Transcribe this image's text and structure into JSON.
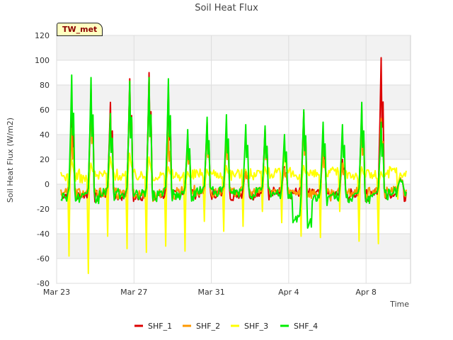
{
  "chart_data": {
    "type": "line",
    "title": "Soil Heat Flux",
    "xlabel": "Time",
    "ylabel": "Soil Heat Flux (W/m2)",
    "tag": "TW_met",
    "ylim": [
      -80,
      120
    ],
    "yticks": [
      -80,
      -60,
      -40,
      -20,
      0,
      20,
      40,
      60,
      80,
      100,
      120
    ],
    "xlim": [
      0,
      18.3
    ],
    "xticks": [
      {
        "t": 0,
        "label": "Mar 23"
      },
      {
        "t": 4,
        "label": "Mar 27"
      },
      {
        "t": 8,
        "label": "Mar 31"
      },
      {
        "t": 12,
        "label": "Apr 4"
      },
      {
        "t": 16,
        "label": "Apr 8"
      }
    ],
    "grid": true,
    "legend_position": "bottom",
    "day_offsets": [
      0.22,
      1.22,
      2.22,
      3.22,
      4.22,
      5.22,
      6.22,
      7.22,
      8.22,
      9.22,
      10.22,
      11.22,
      12.22,
      13.22,
      14.22,
      15.22,
      16.22,
      17.22
    ],
    "series": [
      {
        "name": "SHF_1",
        "color": "#dd0000",
        "peaks": [
          64,
          77,
          66,
          85,
          90,
          79,
          38,
          50,
          45,
          10,
          45,
          14,
          58,
          35,
          20,
          60,
          102,
          5
        ],
        "troughs": [
          -14,
          -14,
          -13,
          -16,
          -16,
          -14,
          -10,
          -12,
          -12,
          -13,
          -11,
          -10,
          -11,
          -13,
          -14,
          -13,
          -12,
          -13
        ]
      },
      {
        "name": "SHF_2",
        "color": "#ff9900",
        "peaks": [
          45,
          73,
          57,
          83,
          85,
          41,
          36,
          48,
          44,
          10,
          44,
          13,
          52,
          30,
          17,
          52,
          53,
          5
        ],
        "troughs": [
          -10,
          -12,
          -11,
          -13,
          -13,
          -12,
          -8,
          -10,
          -11,
          -10,
          -10,
          -9,
          -10,
          -12,
          -12,
          -11,
          -10,
          -9
        ]
      },
      {
        "name": "SHF_3",
        "color": "#ffff00",
        "peaks": [
          20,
          17,
          22,
          25,
          22,
          14,
          10,
          12,
          15,
          12,
          14,
          24,
          15,
          22,
          20,
          14,
          10,
          9
        ],
        "troughs": [
          -58,
          -72,
          -42,
          -52,
          -55,
          -50,
          -54,
          -30,
          -38,
          -34,
          -22,
          -31,
          -42,
          -43,
          -22,
          -46,
          -48,
          -12
        ]
      },
      {
        "name": "SHF_4",
        "color": "#00ee00",
        "peaks": [
          88,
          86,
          57,
          83,
          86,
          85,
          44,
          54,
          56,
          48,
          47,
          40,
          60,
          50,
          48,
          66,
          50,
          4
        ],
        "troughs": [
          -16,
          -18,
          -12,
          -14,
          -14,
          -12,
          -14,
          -8,
          -10,
          -12,
          -10,
          -14,
          -46,
          -18,
          -16,
          -18,
          -12,
          -10
        ]
      }
    ]
  }
}
